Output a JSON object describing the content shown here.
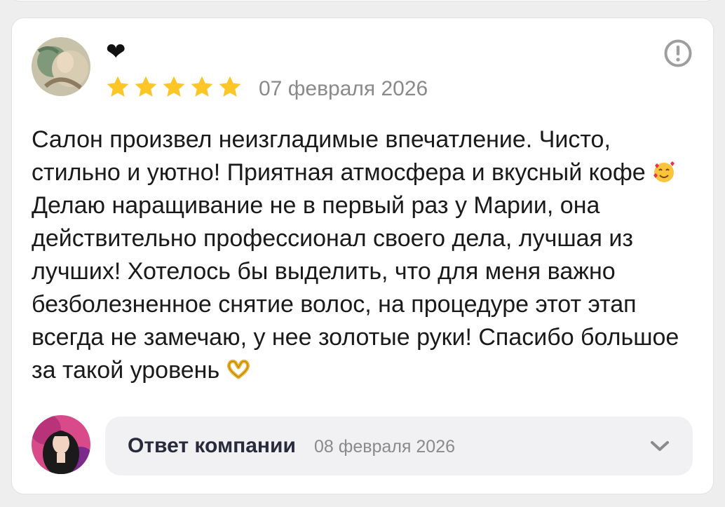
{
  "review": {
    "author_name": "❤",
    "rating": 5,
    "rating_max": 5,
    "date": "07 февраля 2026",
    "text": {
      "part1": "Салон произвел неизгладимые впечатление. Чисто, стильно и уютно! Приятная атмосфера и вкусный кофе ",
      "part2": "Делаю наращивание не в первый раз у Марии, она действительно профессионал своего дела, лучшая из лучших! Хотелось бы выделить, что для меня важно безболезненное снятие волос, на процедуре этот этап всегда не замечаю, у нее золотые руки! Спасибо большое за такой уровень "
    },
    "emoji_1": "smiling-face-with-hearts-icon",
    "emoji_2": "heart-hands-icon",
    "avatar": "avatar-image"
  },
  "reply": {
    "title": "Ответ компании",
    "date": "08 февраля 2026",
    "avatar": "company-avatar-image",
    "expand_icon": "chevron-down-icon"
  },
  "colors": {
    "star": "#fcc626",
    "muted_text": "#8a8a8a",
    "icon_gray": "#9e9e9e",
    "reply_bg": "#f1f1f3"
  }
}
